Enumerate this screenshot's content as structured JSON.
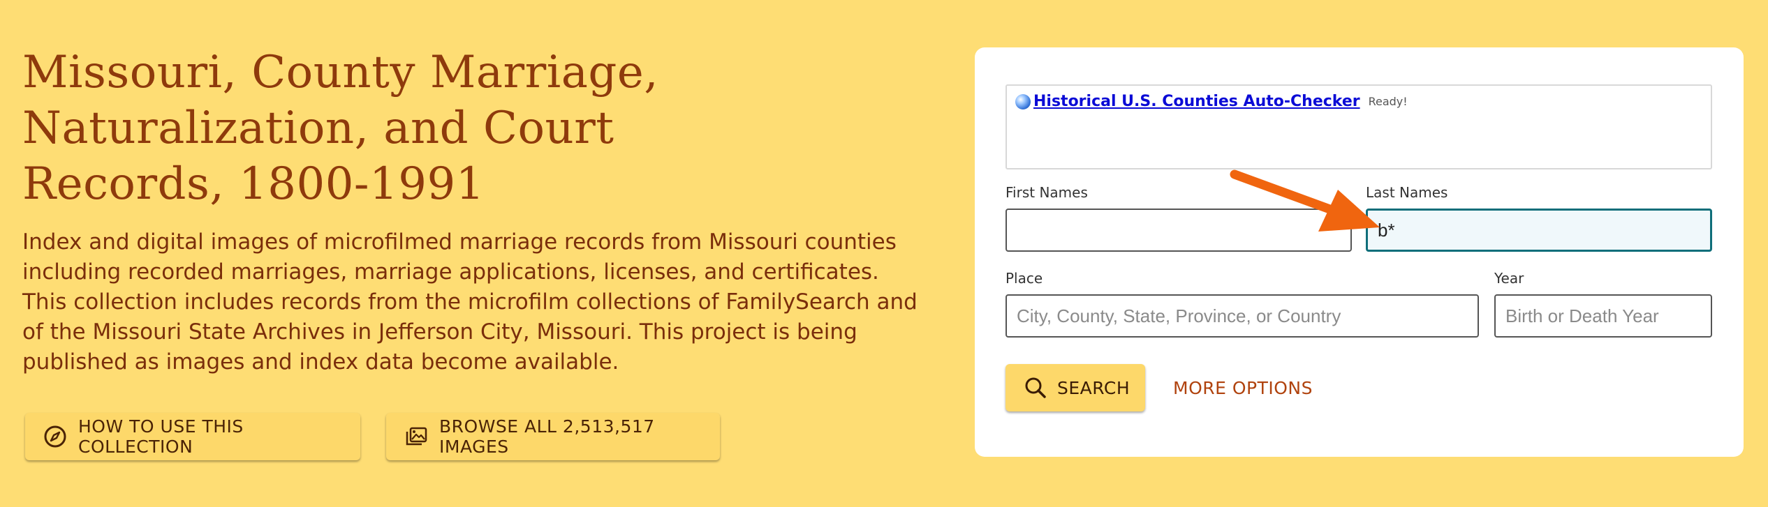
{
  "collection": {
    "title": "Missouri, County Marriage, Naturalization, and Court Records, 1800-1991",
    "description": "Index and digital images of microfilmed marriage records from Missouri counties including recorded marriages, marriage applications, licenses, and certificates. This collection includes records from the microfilm collections of FamilySearch and of the Missouri State Archives in Jefferson City, Missouri. This project is being published as images and index data become available."
  },
  "buttons": {
    "how_to_use": "HOW TO USE THIS COLLECTION",
    "browse_all": "BROWSE ALL 2,513,517 IMAGES"
  },
  "checker": {
    "link_text": "Historical U.S. Counties Auto-Checker",
    "status": "Ready!"
  },
  "form": {
    "first_names": {
      "label": "First Names",
      "value": ""
    },
    "last_names": {
      "label": "Last Names",
      "value": "b*"
    },
    "place": {
      "label": "Place",
      "placeholder": "City, County, State, Province, or Country"
    },
    "year": {
      "label": "Year",
      "placeholder": "Birth or Death Year"
    },
    "search_label": "SEARCH",
    "more_options_label": "MORE OPTIONS"
  },
  "colors": {
    "background": "#FEDD74",
    "title": "#8E3A0C",
    "button": "#FDD86A",
    "focus_border": "#0F6E7A",
    "annotation_arrow": "#F0650F"
  },
  "icons": {
    "how_to_use": "compass-icon",
    "browse_all": "image-gallery-icon",
    "search": "magnifier-icon",
    "checker": "globe-icon"
  }
}
